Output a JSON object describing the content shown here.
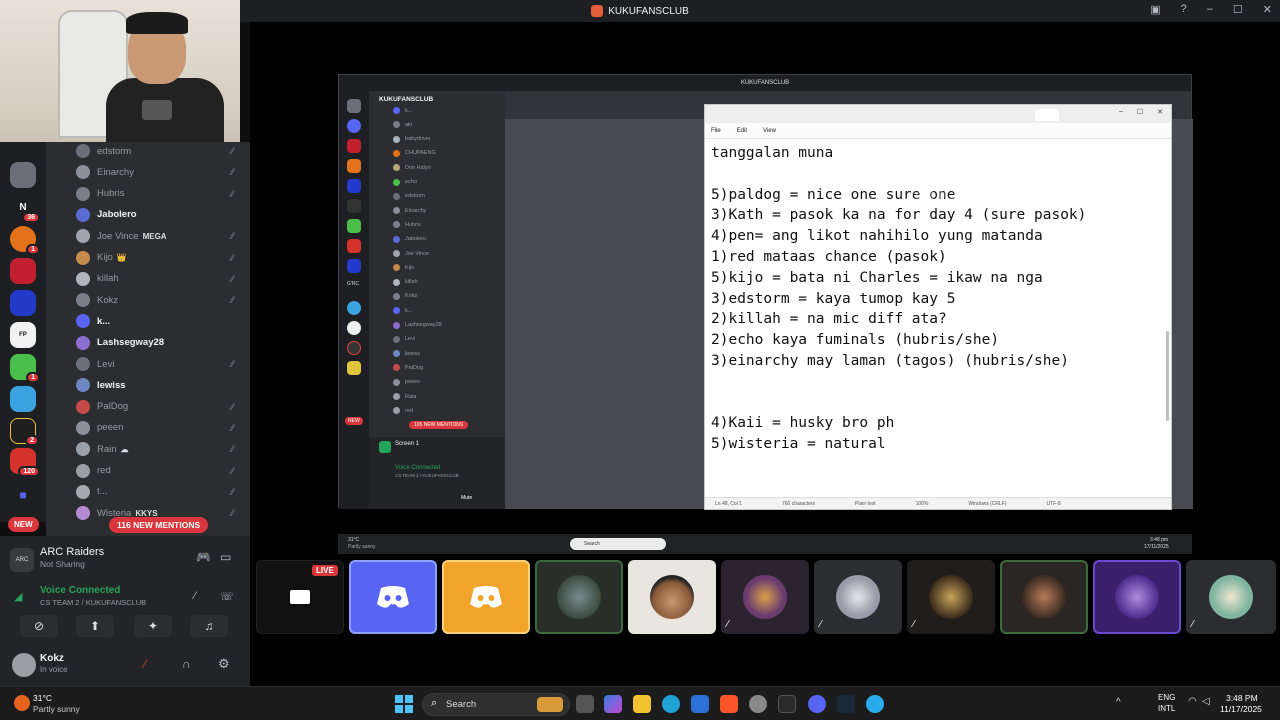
{
  "window": {
    "title": "KUKUFANSCLUB"
  },
  "members": [
    {
      "name": "edstorm",
      "style": "dim",
      "color": "#6b6f7a"
    },
    {
      "name": "Einarchy",
      "style": "dim",
      "color": "#8a8f99"
    },
    {
      "name": "Hubris",
      "style": "dim",
      "color": "#7b8088"
    },
    {
      "name": "Jabolero",
      "style": "bright",
      "color": "#5a6cd6"
    },
    {
      "name": "Joe Vince",
      "style": "dim",
      "tag": "MEGA",
      "color": "#a0a4ad"
    },
    {
      "name": "Kijo",
      "style": "dim",
      "tag": "👑",
      "color": "#c48a4a"
    },
    {
      "name": "killah",
      "style": "dim",
      "color": "#b0b4bb"
    },
    {
      "name": "Kokz",
      "style": "dim",
      "color": "#7a7f88"
    },
    {
      "name": "k...",
      "style": "bright",
      "color": "#5865f2"
    },
    {
      "name": "Lashsegway28",
      "style": "bright",
      "color": "#8c6fd1"
    },
    {
      "name": "Levi",
      "style": "dim",
      "color": "#6a6f79"
    },
    {
      "name": "lewiss",
      "style": "bright",
      "color": "#6e87c2"
    },
    {
      "name": "PalDog",
      "style": "dim",
      "color": "#c44a4a"
    },
    {
      "name": "peeen",
      "style": "dim",
      "color": "#8a8f99"
    },
    {
      "name": "Rain",
      "style": "dim",
      "tag": "☁",
      "color": "#9aa0a8"
    },
    {
      "name": "red",
      "style": "dim",
      "color": "#9c9ea3"
    },
    {
      "name": "t...",
      "style": "dim",
      "color": "#a7a9ae"
    },
    {
      "name": "Wisteria",
      "style": "dim",
      "tag": "KKYS",
      "color": "#b58bd8"
    }
  ],
  "rail": {
    "new_label": "NEW",
    "badges": [
      "36",
      "1",
      "1",
      "2",
      "2",
      "120"
    ]
  },
  "mentions": {
    "label": "116 NEW MENTIONS"
  },
  "activity": {
    "game": "ARC Raiders",
    "status": "Not Sharing"
  },
  "voice": {
    "title": "Voice Connected",
    "channel": "CS TEAM 2 / KUKUFANSCLUB"
  },
  "user": {
    "name": "Kokz",
    "status": "In voice"
  },
  "stream": {
    "live_label": "LIVE",
    "inner_title": "KUKUFANSCLUB",
    "inner_server": "KUKUFANSCLUB",
    "inner_mentions": "105 NEW MENTIONS",
    "inner_screen": "Screen 1",
    "inner_voice": "Voice Connected",
    "inner_voice_channel": "CS TEAM 2 / KUKUFANSCLUB",
    "inner_mute": "Mute",
    "inner_members": [
      "k...",
      "aki",
      "babydriver",
      "CHUPAENG",
      "Don Hidyo",
      "echo",
      "edstorm",
      "Einarchy",
      "Hubris",
      "Jabolero",
      "Joe Vince",
      "Kijo",
      "killah",
      "Kokz",
      "k...",
      "Lashsegway28",
      "Levi",
      "lewiss",
      "PalDog",
      "peeen",
      "Raia",
      "red"
    ],
    "inner_weather": "31°C",
    "inner_weather2": "Partly sunny",
    "inner_search": "Search",
    "inner_time": "3:48 pm",
    "inner_date": "17/11/2025"
  },
  "notepad": {
    "menu": [
      "File",
      "Edit",
      "View"
    ],
    "text": "tanggalan muna\n\n5)paldog = nice one sure one\n3)Kath = pasok ka na for day 4 (sure pasok)\n4)pen= ang likot nahihilo yung matanda\n1)red mataas chance (pasok)\n5)kijo = bata ni Charles = ikaw na nga\n3)edstorm = kaya tumop kay 5\n2)killah = na mic diff ata?\n2)echo kaya fuminals (hubris/she)\n3)einarchy may laman (tagos) (hubris/she)\n\n\n4)Kaii = husky bro ph\n5)wisteria = natural",
    "status": [
      "Ln 48, Col 1",
      "760 characters",
      "Plain text",
      "100%",
      "Windows (CRLF)",
      "UTF-8"
    ]
  },
  "overlay": {
    "text": "29/500",
    "faint": "pang xmas pt "
  },
  "taskbar": {
    "weather_temp": "31°C",
    "weather_desc": "Partly sunny",
    "search": "Search",
    "lang": "ENG",
    "lang2": "INTL",
    "time": "3:48 PM",
    "date": "11/17/2025"
  },
  "colors": {
    "discord": "#5865f2",
    "orange": "#f0a52a",
    "red": "#da373c",
    "green": "#23a55a"
  }
}
